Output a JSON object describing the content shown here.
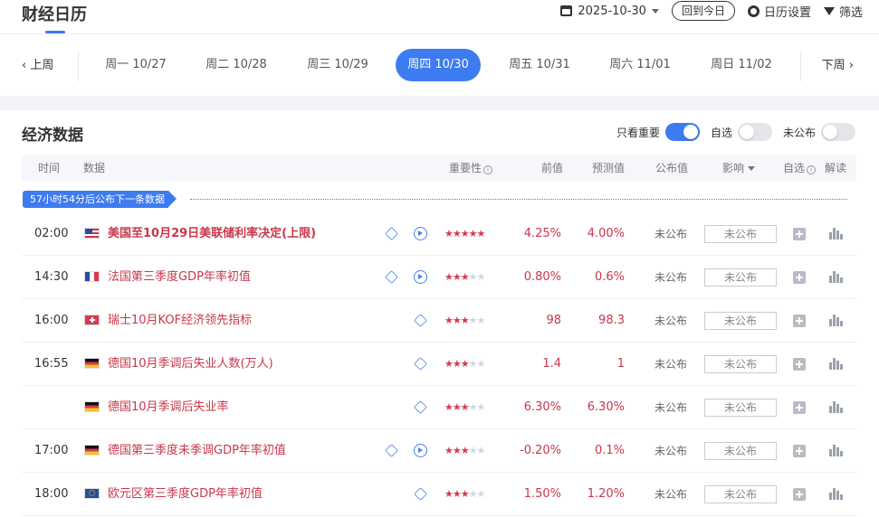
{
  "header": {
    "title": "财经日历",
    "date": "2025-10-30",
    "today_label": "回到今日",
    "settings_label": "日历设置",
    "filter_label": "筛选"
  },
  "week": {
    "prev_label": "上周",
    "next_label": "下周",
    "days": [
      {
        "label": "周一 10/27",
        "active": false
      },
      {
        "label": "周二 10/28",
        "active": false
      },
      {
        "label": "周三 10/29",
        "active": false
      },
      {
        "label": "周四 10/30",
        "active": true
      },
      {
        "label": "周五 10/31",
        "active": false
      },
      {
        "label": "周六 11/01",
        "active": false
      },
      {
        "label": "周日 11/02",
        "active": false
      }
    ]
  },
  "section": {
    "title": "经济数据",
    "toggles": [
      {
        "label": "只看重要",
        "on": true
      },
      {
        "label": "自选",
        "on": false
      },
      {
        "label": "未公布",
        "on": false
      }
    ]
  },
  "table": {
    "columns": {
      "time": "时间",
      "data": "数据",
      "importance": "重要性",
      "previous": "前值",
      "forecast": "预测值",
      "actual": "公布值",
      "impact": "影响",
      "watch": "自选",
      "explain": "解读"
    },
    "countdown": "57小时54分后公布下一条数据",
    "rows": [
      {
        "time": "02:00",
        "flag": "us",
        "name": "美国至10月29日美联储利率决定(上限)",
        "bold": true,
        "cube": true,
        "play": true,
        "stars": 5,
        "previous": "4.25%",
        "forecast": "4.00%",
        "actual": "未公布",
        "impact": "未公布"
      },
      {
        "time": "14:30",
        "flag": "fr",
        "name": "法国第三季度GDP年率初值",
        "bold": false,
        "cube": true,
        "play": true,
        "stars": 3,
        "previous": "0.80%",
        "forecast": "0.6%",
        "actual": "未公布",
        "impact": "未公布"
      },
      {
        "time": "16:00",
        "flag": "ch",
        "name": "瑞士10月KOF经济领先指标",
        "bold": false,
        "cube": true,
        "play": false,
        "stars": 3,
        "previous": "98",
        "forecast": "98.3",
        "actual": "未公布",
        "impact": "未公布"
      },
      {
        "time": "16:55",
        "flag": "de",
        "name": "德国10月季调后失业人数(万人)",
        "bold": false,
        "cube": true,
        "play": false,
        "stars": 3,
        "previous": "1.4",
        "forecast": "1",
        "actual": "未公布",
        "impact": "未公布"
      },
      {
        "time": "",
        "flag": "de",
        "name": "德国10月季调后失业率",
        "bold": false,
        "cube": true,
        "play": false,
        "stars": 3,
        "previous": "6.30%",
        "forecast": "6.30%",
        "actual": "未公布",
        "impact": "未公布"
      },
      {
        "time": "17:00",
        "flag": "de",
        "name": "德国第三季度未季调GDP年率初值",
        "bold": false,
        "cube": true,
        "play": true,
        "stars": 3,
        "previous": "-0.20%",
        "forecast": "0.1%",
        "actual": "未公布",
        "impact": "未公布"
      },
      {
        "time": "18:00",
        "flag": "eu",
        "name": "欧元区第三季度GDP年率初值",
        "bold": false,
        "cube": true,
        "play": false,
        "stars": 3,
        "previous": "1.50%",
        "forecast": "1.20%",
        "actual": "未公布",
        "impact": "未公布"
      }
    ]
  },
  "colors": {
    "accent": "#3d7bf0",
    "value_red": "#c8374b",
    "star_on": "#d9394e",
    "star_off": "#d3d6db"
  }
}
